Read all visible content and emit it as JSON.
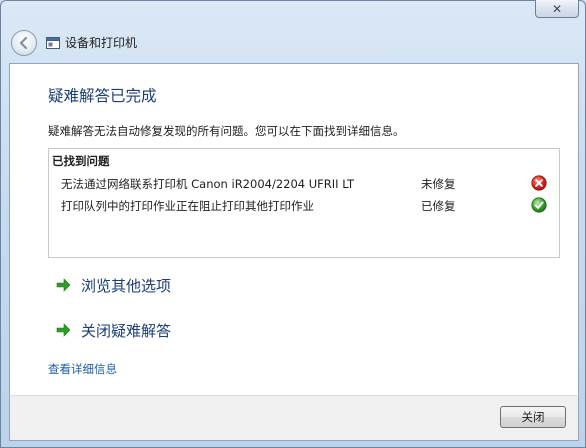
{
  "window": {
    "close_glyph": "✕"
  },
  "nav": {
    "title": "设备和打印机"
  },
  "main": {
    "heading": "疑难解答已完成",
    "subtitle": "疑难解答无法自动修复发现的所有问题。您可以在下面找到详细信息。",
    "issues_title": "已找到问题",
    "issues": [
      {
        "text": "无法通过网络联系打印机 Canon iR2004/2204 UFRII LT",
        "status": "未修复",
        "icon": "error-icon"
      },
      {
        "text": "打印队列中的打印作业正在阻止打印其他打印作业",
        "status": "已修复",
        "icon": "success-icon"
      }
    ],
    "links": [
      {
        "label": "浏览其他选项",
        "icon": "green-arrow-icon"
      },
      {
        "label": "关闭疑难解答",
        "icon": "green-arrow-icon"
      }
    ],
    "detail_link": "查看详细信息"
  },
  "footer": {
    "close_label": "关闭"
  },
  "colors": {
    "heading": "#1b3d78",
    "link": "#1f5bb0",
    "error": "#d8261c",
    "success": "#3a9c2e",
    "arrow": "#2e9d2a"
  }
}
